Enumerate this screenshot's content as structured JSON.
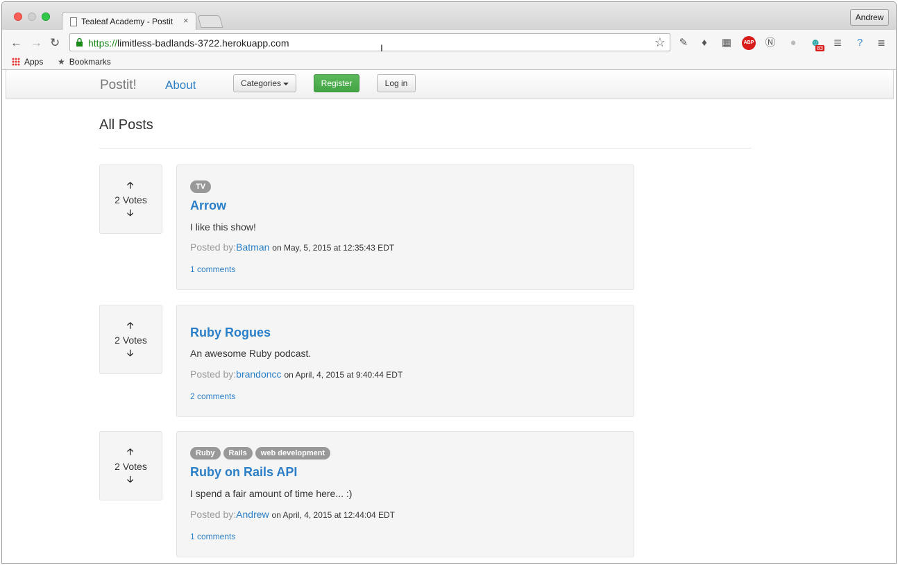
{
  "browser": {
    "tab_title": "Tealeaf Academy - Postit",
    "tab_close": "×",
    "profile_name": "Andrew",
    "url_scheme": "https://",
    "url_rest": "limitless-badlands-3722.herokuapp.com",
    "extension_badge": "83",
    "bookmarks": {
      "apps": "Apps",
      "bookmarks": "Bookmarks"
    }
  },
  "navbar": {
    "brand": "Postit!",
    "about": "About",
    "categories": "Categories",
    "register": "Register",
    "login": "Log in"
  },
  "page": {
    "header": "All Posts"
  },
  "posts": [
    {
      "votes": "2 Votes",
      "categories": [
        "TV"
      ],
      "title": "Arrow",
      "description": "I like this show!",
      "posted_by_label": "Posted by:",
      "author": "Batman",
      "date": "on May, 5, 2015 at 12:35:43 EDT",
      "comments": "1 comments"
    },
    {
      "votes": "2 Votes",
      "categories": [],
      "title": "Ruby Rogues",
      "description": "An awesome Ruby podcast.",
      "posted_by_label": "Posted by:",
      "author": "brandoncc",
      "date": "on April, 4, 2015 at 9:40:44 EDT",
      "comments": "2 comments"
    },
    {
      "votes": "2 Votes",
      "categories": [
        "Ruby",
        "Rails",
        "web development"
      ],
      "title": "Ruby on Rails API",
      "description": "I spend a fair amount of time here... :)",
      "posted_by_label": "Posted by:",
      "author": "Andrew",
      "date": "on April, 4, 2015 at 12:44:04 EDT",
      "comments": "1 comments"
    }
  ],
  "colors": {
    "link": "#2a7fc8",
    "register_button": "#5cb85c",
    "badge": "#999999",
    "url_https": "#1a8a1a"
  }
}
